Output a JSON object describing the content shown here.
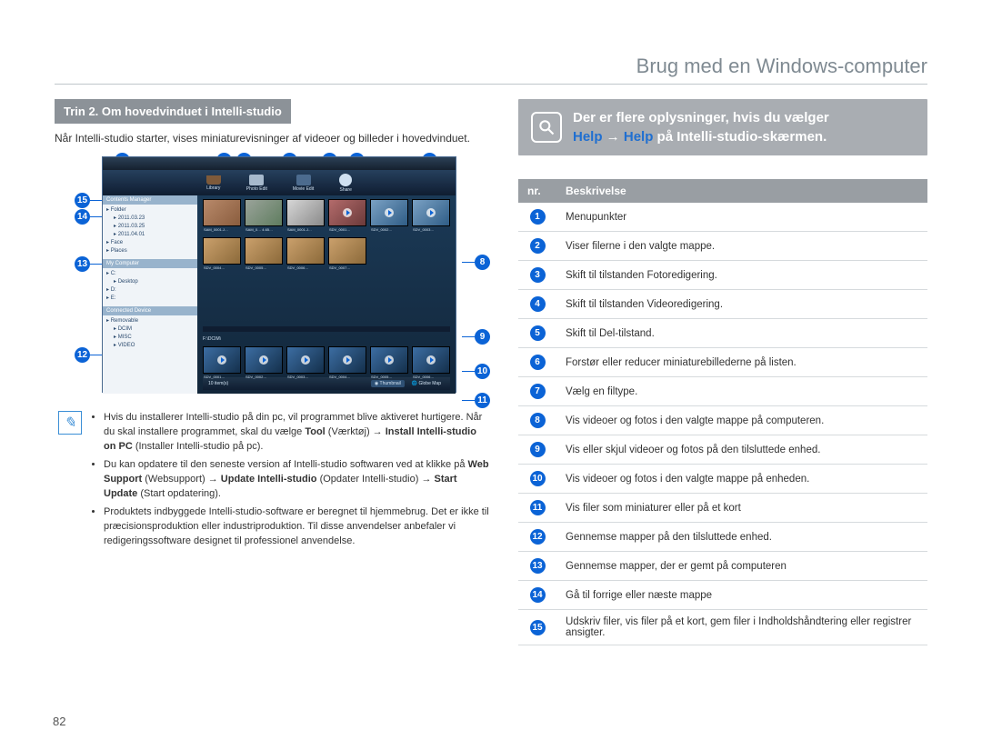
{
  "page": {
    "title": "Brug med en Windows-computer",
    "number": "82"
  },
  "left": {
    "step_header": "Trin 2. Om hovedvinduet i Intelli-studio",
    "intro": "Når Intelli-studio starter, vises miniaturevisninger af videoer og billeder i hovedvinduet.",
    "screenshot": {
      "tabs": [
        "Library",
        "Photo Edit",
        "Movie Edit",
        "Share"
      ],
      "side": {
        "manager_hdr": "Contents Manager",
        "folder": "Folder",
        "dates": [
          "2011.03.23",
          "2011.03.25",
          "2011.04.01"
        ],
        "face": "Face",
        "places": "Places",
        "mycomp": "My Computer",
        "drives": [
          "C:",
          "Desktop",
          "D:",
          "E:"
        ],
        "connected_hdr": "Connected Device",
        "dev": "Removable",
        "devsub": [
          "DCIM",
          "MISC",
          "VIDEO"
        ]
      },
      "path": "F:\\DCIM\\",
      "footer_left": "10 item(s)",
      "footer_tabs": [
        "Thumbnail",
        "Globe Map"
      ]
    },
    "notes": {
      "icon_char": "✎",
      "items": [
        {
          "pre": "Hvis du installerer Intelli-studio på din pc, vil programmet blive aktiveret hurtigere. Når du skal installere programmet, skal du vælge ",
          "b1": "Tool",
          "p1": " (Værktøj) → ",
          "b2": "Install Intelli-studio on PC",
          "p2": " (Installer Intelli-studio på pc)."
        },
        {
          "pre": "Du kan opdatere til den seneste version af Intelli-studio softwaren ved at klikke på ",
          "b1": "Web Support",
          "p1": " (Websupport) → ",
          "b2": "Update Intelli-studio",
          "p2": " (Opdater Intelli-studio) → ",
          "b3": "Start Update",
          "p3": " (Start opdatering)."
        },
        {
          "pre": "Produktets indbyggede Intelli-studio-software er beregnet til hjemmebrug. Det er ikke til præcisionsproduktion eller industriproduktion. Til disse anvendelser anbefaler vi redigeringssoftware designet til professionel anvendelse."
        }
      ]
    }
  },
  "right": {
    "tip": {
      "l1": "Der er flere oplysninger, hvis du vælger ",
      "h1": "Help",
      "arrow": " → ",
      "h2": "Help",
      "l2": " på Intelli-studio-skærmen."
    },
    "table": {
      "headers": [
        "nr.",
        "Beskrivelse"
      ],
      "rows": [
        "Menupunkter",
        "Viser filerne i den valgte mappe.",
        "Skift til tilstanden Fotoredigering.",
        "Skift til tilstanden Videoredigering.",
        "Skift til Del-tilstand.",
        "Forstør eller reducer miniaturebillederne på listen.",
        "Vælg en filtype.",
        "Vis videoer og fotos i den valgte mappe på computeren.",
        "Vis eller skjul videoer og fotos på den tilsluttede enhed.",
        "Vis videoer og fotos i den valgte mappe på enheden.",
        "Vis filer som miniaturer eller på et kort",
        "Gennemse mapper på den tilsluttede enhed.",
        "Gennemse mapper, der er gemt på computeren",
        "Gå til forrige eller næste mappe",
        "Udskriv filer, vis filer på et kort, gem filer i Indholdshåndtering eller registrer ansigter."
      ]
    }
  }
}
